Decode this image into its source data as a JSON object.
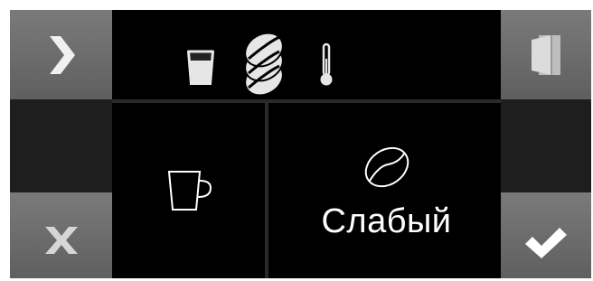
{
  "colors": {
    "background": "#000000",
    "side_button": "#6b6b6b",
    "side_dark": "#1e1e1e",
    "icon_light": "#e6e6e6",
    "icon_outline": "#ffffff"
  },
  "top_bar": {
    "icons": [
      "glass-icon",
      "coffee-beans-stack-icon",
      "thermometer-icon"
    ]
  },
  "left_buttons": {
    "next_icon": "chevron-right-icon",
    "cancel_icon": "close-x-icon"
  },
  "right_buttons": {
    "door_icon": "door-exit-icon",
    "confirm_icon": "checkmark-icon"
  },
  "main": {
    "cup_icon": "cup-icon",
    "strength": {
      "icon": "coffee-bean-outline-icon",
      "label": "Слабый"
    }
  }
}
